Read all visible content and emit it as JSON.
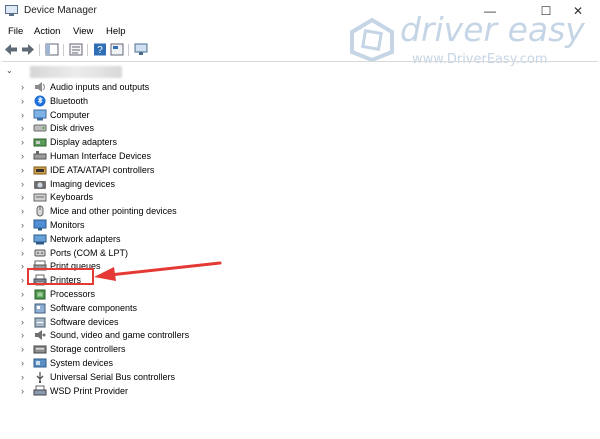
{
  "window": {
    "title": "Device Manager",
    "controls": [
      "—",
      "☐",
      "✕"
    ]
  },
  "menu": [
    "File",
    "Action",
    "View",
    "Help"
  ],
  "watermark": {
    "brand": "driver easy",
    "url": "www.DriverEasy.com"
  },
  "tree": {
    "items": [
      {
        "label": "Audio inputs and outputs",
        "icon": "speaker-icon"
      },
      {
        "label": "Bluetooth",
        "icon": "bluetooth-icon"
      },
      {
        "label": "Computer",
        "icon": "computer-icon"
      },
      {
        "label": "Disk drives",
        "icon": "disk-drive-icon"
      },
      {
        "label": "Display adapters",
        "icon": "display-adapter-icon"
      },
      {
        "label": "Human Interface Devices",
        "icon": "hid-icon"
      },
      {
        "label": "IDE ATA/ATAPI controllers",
        "icon": "ide-controller-icon"
      },
      {
        "label": "Imaging devices",
        "icon": "camera-icon"
      },
      {
        "label": "Keyboards",
        "icon": "keyboard-icon"
      },
      {
        "label": "Mice and other pointing devices",
        "icon": "mouse-icon"
      },
      {
        "label": "Monitors",
        "icon": "monitor-icon"
      },
      {
        "label": "Network adapters",
        "icon": "network-adapter-icon"
      },
      {
        "label": "Ports (COM & LPT)",
        "icon": "port-icon"
      },
      {
        "label": "Print queues",
        "icon": "print-queue-icon"
      },
      {
        "label": "Printers",
        "icon": "printer-icon"
      },
      {
        "label": "Processors",
        "icon": "processor-icon"
      },
      {
        "label": "Software components",
        "icon": "software-component-icon"
      },
      {
        "label": "Software devices",
        "icon": "software-device-icon"
      },
      {
        "label": "Sound, video and game controllers",
        "icon": "sound-controller-icon"
      },
      {
        "label": "Storage controllers",
        "icon": "storage-controller-icon"
      },
      {
        "label": "System devices",
        "icon": "system-device-icon"
      },
      {
        "label": "Universal Serial Bus controllers",
        "icon": "usb-icon"
      },
      {
        "label": "WSD Print Provider",
        "icon": "wsd-printer-icon"
      }
    ]
  },
  "colors": {
    "highlight": "#e53935",
    "accent": "#2f6fb5"
  }
}
